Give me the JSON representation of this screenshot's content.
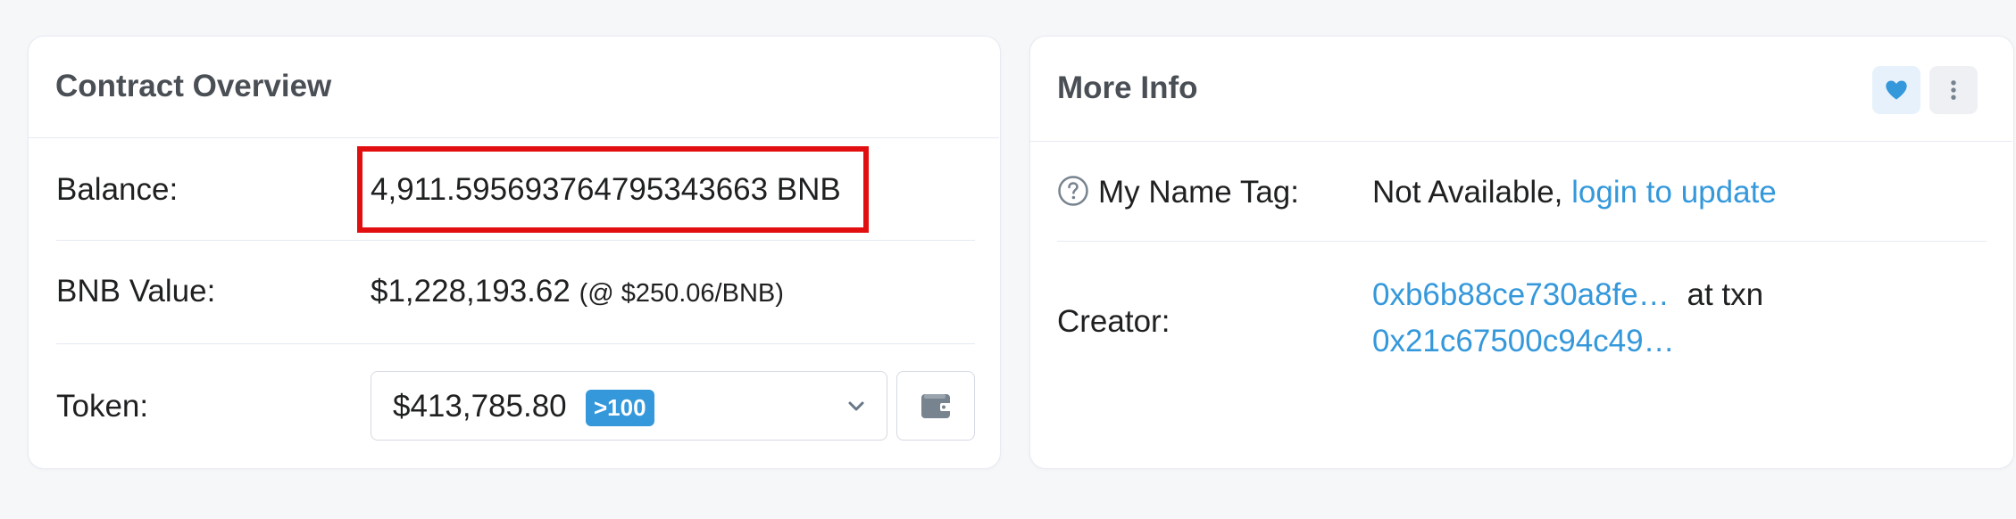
{
  "overview": {
    "title": "Contract Overview",
    "balance_label": "Balance:",
    "balance_value": "4,911.595693764795343663 BNB",
    "bnb_value_label": "BNB Value:",
    "bnb_value": "$1,228,193.62",
    "bnb_rate": "(@ $250.06/BNB)",
    "token_label": "Token:",
    "token_amount": "$413,785.80",
    "token_badge": ">100",
    "token_dropdown_icon": "chevron-down-icon",
    "wallet_icon": "wallet-icon"
  },
  "more_info": {
    "title": "More Info",
    "name_tag_label": "My Name Tag:",
    "name_tag_value": "Not Available,",
    "name_tag_link": "login to update",
    "creator_label": "Creator:",
    "creator_address": "0xb6b88ce730a8fe…",
    "creator_at_txn": "at txn",
    "creator_txn": "0x21c67500c94c49…",
    "favorite_icon": "heart-icon",
    "more_icon": "more-vertical-icon"
  },
  "colors": {
    "link": "#3498db",
    "highlight_border": "#e20f10",
    "badge_bg": "#3498db"
  }
}
